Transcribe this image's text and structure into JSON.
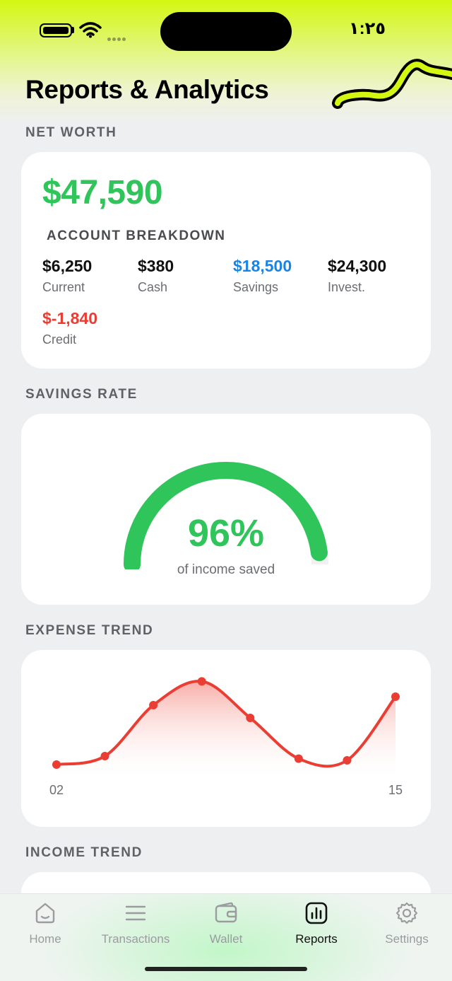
{
  "status_bar": {
    "time": "١:٢٥",
    "battery_icon": "battery-icon",
    "wifi_icon": "wifi-icon",
    "signal_icon": "cellular-signal-icon"
  },
  "header": {
    "title": "Reports & Analytics"
  },
  "net_worth": {
    "section_label": "NET WORTH",
    "value": "$47,590",
    "breakdown_title": "ACCOUNT BREAKDOWN",
    "accounts": [
      {
        "amount": "$6,250",
        "label": "Current"
      },
      {
        "amount": "$380",
        "label": "Cash"
      },
      {
        "amount": "$18,500",
        "label": "Savings"
      },
      {
        "amount": "$24,300",
        "label": "Invest."
      },
      {
        "amount": "$-1,840",
        "label": "Credit"
      }
    ]
  },
  "savings_rate": {
    "section_label": "SAVINGS RATE",
    "percent": 96,
    "value_text": "96%",
    "caption": "of income saved"
  },
  "expense_trend": {
    "section_label": "EXPENSE TREND"
  },
  "income_trend": {
    "section_label": "INCOME TREND"
  },
  "tabs": [
    {
      "label": "Home",
      "icon": "home-icon",
      "active": false
    },
    {
      "label": "Transactions",
      "icon": "list-icon",
      "active": false
    },
    {
      "label": "Wallet",
      "icon": "wallet-icon",
      "active": false
    },
    {
      "label": "Reports",
      "icon": "bar-chart-icon",
      "active": true
    },
    {
      "label": "Settings",
      "icon": "gear-icon",
      "active": false
    }
  ],
  "colors": {
    "accent_lime": "#d4f711",
    "positive_green": "#2fc55a",
    "savings_blue": "#1a84e5",
    "negative_red": "#ea3d33"
  },
  "chart_data": {
    "type": "area",
    "title": "",
    "xlabel": "",
    "ylabel": "",
    "x_tick_labels": [
      "02",
      "15"
    ],
    "series": [
      {
        "values": [
          15,
          25,
          85,
          113,
          70,
          22,
          20,
          95
        ],
        "color": "#ea3d33"
      }
    ],
    "ylim": [
      0,
      125
    ],
    "grid": false
  }
}
